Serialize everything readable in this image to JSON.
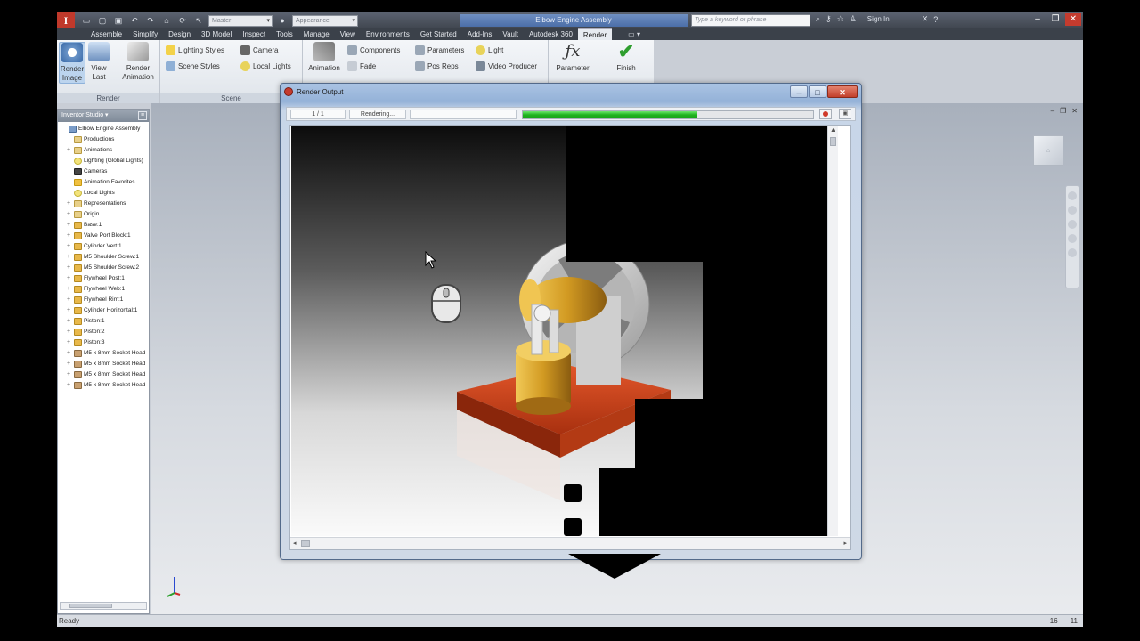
{
  "titlebar": {
    "logo": "I",
    "project_select": "Master",
    "appearance_select": "Appearance",
    "document_title": "Elbow Engine Assembly",
    "search_placeholder": "Type a keyword or phrase",
    "sign_in": "Sign In"
  },
  "tabs": [
    "Assemble",
    "Simplify",
    "Design",
    "3D Model",
    "Inspect",
    "Tools",
    "Manage",
    "View",
    "Environments",
    "Get Started",
    "Add-Ins",
    "Vault",
    "Autodesk 360",
    "Render"
  ],
  "active_tab": "Render",
  "ribbon": {
    "render_panel": {
      "title": "Render",
      "render_image": "Render Image",
      "view_last": "View Last",
      "render_animation": "Render Animation"
    },
    "scene_panel": {
      "title": "Scene",
      "lighting_styles": "Lighting Styles",
      "scene_styles": "Scene Styles",
      "camera": "Camera",
      "local_lights": "Local Lights"
    },
    "animate_panel": {
      "animation": "Animation",
      "components": "Components",
      "fade": "Fade",
      "parameters": "Parameters",
      "pos_reps": "Pos Reps",
      "light": "Light",
      "video_producer": "Video Producer"
    },
    "parameter_panel": {
      "parameter": "Parameter"
    },
    "finish_panel": {
      "finish": "Finish"
    }
  },
  "browser": {
    "title": "Inventor Studio",
    "items": [
      {
        "label": "Elbow Engine Assembly",
        "icon": "doc",
        "exp": ""
      },
      {
        "label": "Productions",
        "icon": "folder",
        "exp": ""
      },
      {
        "label": "Animations",
        "icon": "folder",
        "exp": "+"
      },
      {
        "label": "Lighting (Global Lights)",
        "icon": "light",
        "exp": ""
      },
      {
        "label": "Cameras",
        "icon": "cam",
        "exp": ""
      },
      {
        "label": "Animation Favorites",
        "icon": "star",
        "exp": ""
      },
      {
        "label": "Local Lights",
        "icon": "light",
        "exp": ""
      },
      {
        "label": "Representations",
        "icon": "folder",
        "exp": "+"
      },
      {
        "label": "Origin",
        "icon": "folder",
        "exp": "+"
      },
      {
        "label": "Base:1",
        "icon": "part",
        "exp": "+"
      },
      {
        "label": "Valve Port Block:1",
        "icon": "part",
        "exp": "+"
      },
      {
        "label": "Cylinder Vert:1",
        "icon": "part",
        "exp": "+"
      },
      {
        "label": "M5 Shoulder Screw:1",
        "icon": "part",
        "exp": "+"
      },
      {
        "label": "M5 Shoulder Screw:2",
        "icon": "part",
        "exp": "+"
      },
      {
        "label": "Flywheel Post:1",
        "icon": "part",
        "exp": "+"
      },
      {
        "label": "Flywheel Web:1",
        "icon": "part",
        "exp": "+"
      },
      {
        "label": "Flywheel Rim:1",
        "icon": "part",
        "exp": "+"
      },
      {
        "label": "Cylinder Horizontal:1",
        "icon": "part",
        "exp": "+"
      },
      {
        "label": "Piston:1",
        "icon": "part",
        "exp": "+"
      },
      {
        "label": "Piston:2",
        "icon": "part",
        "exp": "+"
      },
      {
        "label": "Piston:3",
        "icon": "part",
        "exp": "+"
      },
      {
        "label": "M5 x 8mm Socket Head",
        "icon": "bolt",
        "exp": "+"
      },
      {
        "label": "M5 x 8mm Socket Head",
        "icon": "bolt",
        "exp": "+"
      },
      {
        "label": "M5 x 8mm Socket Head",
        "icon": "bolt",
        "exp": "+"
      },
      {
        "label": "M5 x 8mm Socket Head",
        "icon": "bolt",
        "exp": "+"
      }
    ]
  },
  "render_window": {
    "title": "Render Output",
    "frame": "1 / 1",
    "status": "Rendering...",
    "progress": 0.6
  },
  "statusbar": {
    "status": "Ready",
    "count1": "16",
    "count2": "11"
  },
  "colors": {
    "accent_green": "#1fb31f",
    "base_red": "#c23a12",
    "brass": "#d9a42a"
  }
}
